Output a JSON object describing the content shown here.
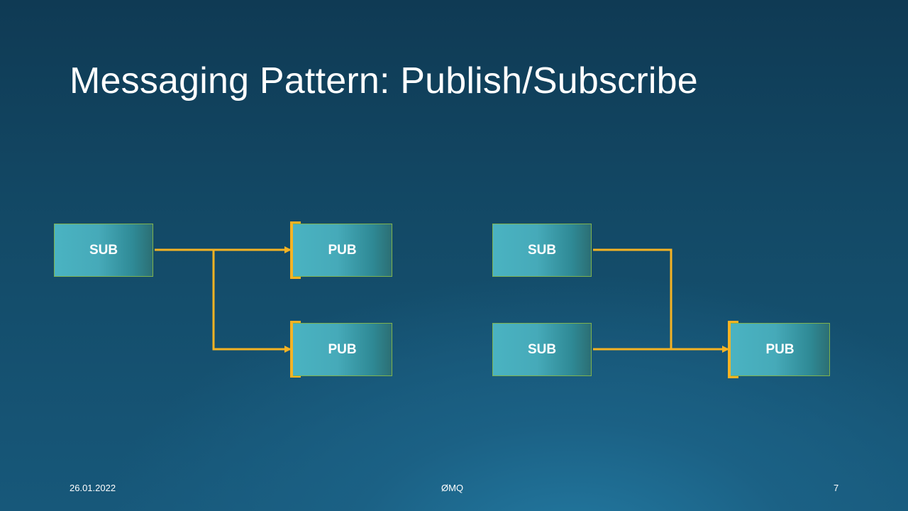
{
  "slide": {
    "title": "Messaging Pattern: Publish/Subscribe"
  },
  "diagram": {
    "left": {
      "sub": "SUB",
      "pub_top": "PUB",
      "pub_bottom": "PUB"
    },
    "right": {
      "sub_top": "SUB",
      "sub_bottom": "SUB",
      "pub": "PUB"
    }
  },
  "colors": {
    "connector": "#f5b323",
    "node_fill": "#4ab3c2",
    "node_border": "#7fb24e"
  },
  "footer": {
    "date": "26.01.2022",
    "center": "ØMQ",
    "page": "7"
  }
}
